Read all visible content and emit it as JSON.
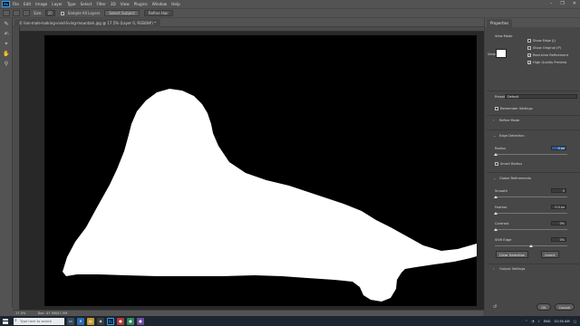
{
  "app": {
    "logo": "Ps",
    "menu": [
      "File",
      "Edit",
      "Image",
      "Layer",
      "Type",
      "Select",
      "Filter",
      "3D",
      "View",
      "Plugins",
      "Window",
      "Help"
    ],
    "window_controls": [
      "–",
      "❐",
      "✕"
    ]
  },
  "options_bar": {
    "size_label": "Size:",
    "size_value": "20",
    "sample_all_layers": "Sample All Layers",
    "select_subject": "Select Subject",
    "refine_hair": "Refine Hair"
  },
  "document": {
    "tab_title": "© lion-male-looking-vivid-living-mountain.jpg @ 17.5% (Layer 0, RGB/8#) *",
    "zoom": "17.5%",
    "doc_size": "Doc: 47.5M/47.5M"
  },
  "tools": [
    "✎",
    "✍",
    "⌖",
    "✋",
    "⚲"
  ],
  "properties": {
    "panel_title": "Properties",
    "view_mode_label": "View Mode",
    "view_label": "View:",
    "show_edge": "Show Edge (J)",
    "show_original": "Show Original (P)",
    "realtime_refinement": "Real-time Refinement",
    "high_quality_preview": "High Quality Preview",
    "preset_label": "Preset:",
    "preset_value": "Default",
    "remember_settings": "Remember Settings",
    "refine_mode": "Refine Mode",
    "edge_detection": "Edge Detection",
    "radius_label": "Radius",
    "radius_value": "0 px",
    "smart_radius": "Smart Radius",
    "global_refinements": "Global Refinements",
    "smooth_label": "Smooth",
    "smooth_value": "0",
    "feather_label": "Feather",
    "feather_value": "0.0 px",
    "contrast_label": "Contrast",
    "contrast_value": "0%",
    "shift_edge_label": "Shift Edge",
    "shift_edge_value": "0%",
    "clear_selection": "Clear Selection",
    "invert": "Invert",
    "output_settings": "Output Settings",
    "ok": "OK",
    "cancel": "Cancel"
  },
  "taskbar": {
    "search_placeholder": "Type here to search",
    "lang": "ENG",
    "time": "01:50 AM",
    "date": "01/24/2024"
  },
  "colors": {
    "ui_bg": "#535353",
    "panel_bg": "#474747",
    "canvas_bg": "#000000",
    "mask_fg": "#ffffff",
    "accent": "#2a5e9c",
    "taskbar": "#1c2530"
  }
}
